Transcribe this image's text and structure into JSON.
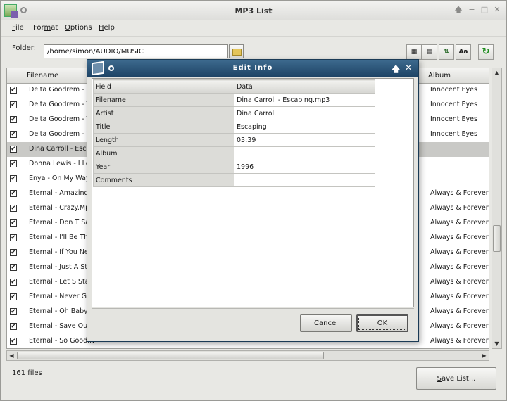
{
  "window": {
    "title": "MP3 List"
  },
  "menu": [
    {
      "pre": "",
      "ul": "F",
      "post": "ile"
    },
    {
      "pre": "For",
      "ul": "m",
      "post": "at"
    },
    {
      "pre": "",
      "ul": "O",
      "post": "ptions"
    },
    {
      "pre": "",
      "ul": "H",
      "post": "elp"
    }
  ],
  "toolbar": {
    "folder_pre": "Fol",
    "folder_ul": "d",
    "folder_post": "er:",
    "folder_value": "/home/simon/AUDIO/MUSIC",
    "case_label": "Aa"
  },
  "list": {
    "columns": {
      "filename": "Filename",
      "album": "Album"
    },
    "rows": [
      {
        "file": "Delta Goodrem - Ro",
        "album": "Innocent Eyes",
        "checked": true
      },
      {
        "file": "Delta Goodrem - Th",
        "album": "Innocent Eyes",
        "checked": true
      },
      {
        "file": "Delta Goodrem - Th",
        "album": "Innocent Eyes",
        "checked": true
      },
      {
        "file": "Delta Goodrem - W",
        "album": "Innocent Eyes",
        "checked": true
      },
      {
        "file": "Dina Carroll - Escap",
        "album": "",
        "checked": true,
        "selected": true
      },
      {
        "file": "Donna Lewis - I Lov",
        "album": "",
        "checked": true
      },
      {
        "file": "Enya - On My Way I",
        "album": "",
        "checked": true
      },
      {
        "file": "Eternal - Amazing",
        "album": "Always & Forever",
        "checked": true
      },
      {
        "file": "Eternal - Crazy.Mp",
        "album": "Always & Forever",
        "checked": true
      },
      {
        "file": "Eternal - Don T Say",
        "album": "Always & Forever",
        "checked": true
      },
      {
        "file": "Eternal - I'll Be The",
        "album": "Always & Forever",
        "checked": true
      },
      {
        "file": "Eternal - If You Nee",
        "album": "Always & Forever",
        "checked": true
      },
      {
        "file": "Eternal - Just A Ste",
        "album": "Always & Forever",
        "checked": true
      },
      {
        "file": "Eternal - Let S Stay",
        "album": "Always & Forever",
        "checked": true
      },
      {
        "file": "Eternal - Never Gor",
        "album": "Always & Forever",
        "checked": true
      },
      {
        "file": "Eternal - Oh Baby I",
        "album": "Always & Forever",
        "checked": true
      },
      {
        "file": "Eternal - Save Our",
        "album": "Always & Forever",
        "checked": true
      },
      {
        "file": "Eternal - So Good.N",
        "album": "Always & Forever",
        "checked": true
      }
    ]
  },
  "status": {
    "count": "161 files"
  },
  "save_button": {
    "ul": "S",
    "post": "ave List..."
  },
  "dialog": {
    "title": "Edit Info",
    "headers": {
      "field": "Field",
      "data": "Data"
    },
    "fields": [
      {
        "name": "Filename",
        "value": "Dina Carroll - Escaping.mp3"
      },
      {
        "name": "Artist",
        "value": "Dina Carroll"
      },
      {
        "name": "Title",
        "value": "Escaping"
      },
      {
        "name": "Length",
        "value": "03:39"
      },
      {
        "name": "Album",
        "value": ""
      },
      {
        "name": "Year",
        "value": "1996"
      },
      {
        "name": "Comments",
        "value": ""
      }
    ],
    "cancel": {
      "ul": "C",
      "post": "ancel"
    },
    "ok": {
      "ul": "O",
      "post": "K"
    }
  }
}
